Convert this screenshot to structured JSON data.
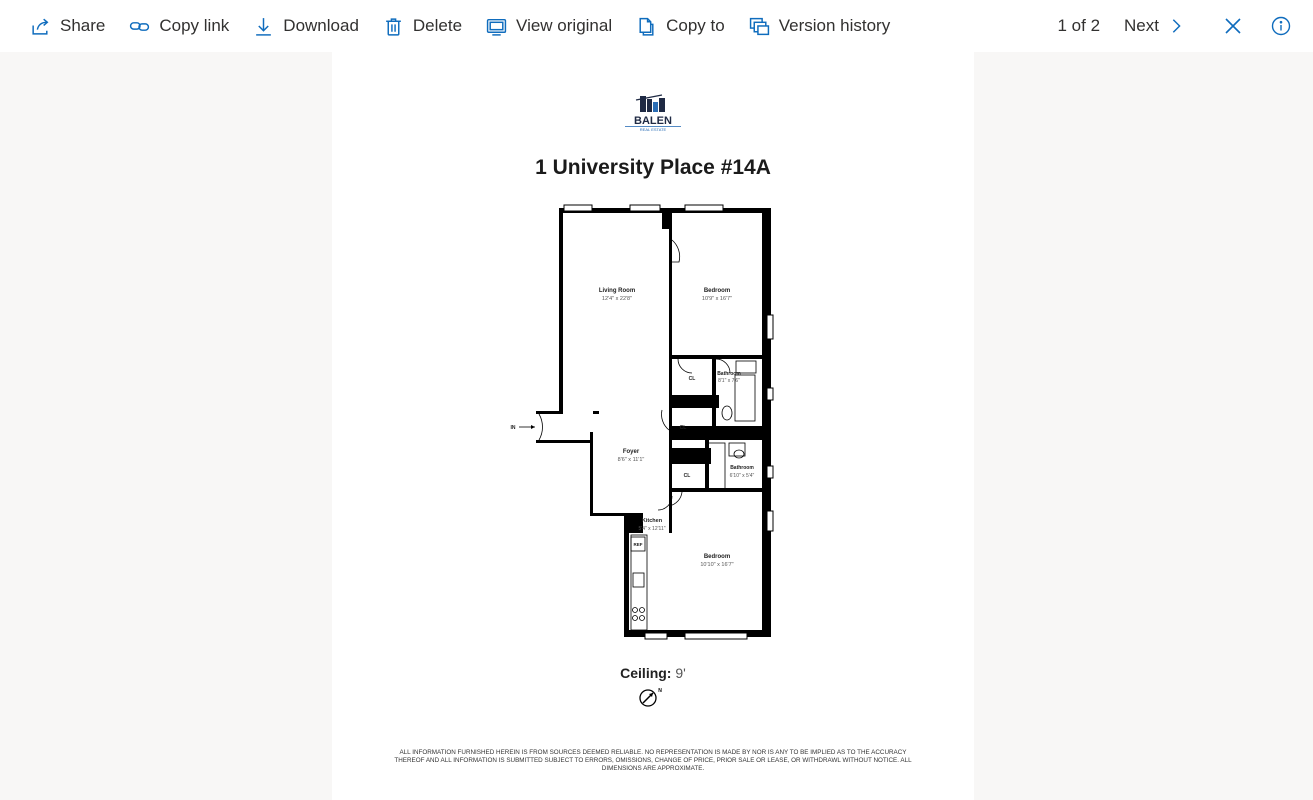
{
  "toolbar": {
    "share": "Share",
    "copy_link": "Copy link",
    "download": "Download",
    "delete": "Delete",
    "view_original": "View original",
    "copy_to": "Copy to",
    "version_history": "Version history",
    "counter": "1 of 2",
    "next": "Next"
  },
  "document": {
    "logo_text": "BALEN",
    "logo_subtext": "REAL ESTATE",
    "title": "1 University Place #14A",
    "entry_label": "IN",
    "rooms": [
      {
        "name": "Living Room",
        "dims": "12'4\" x 22'8\""
      },
      {
        "name": "Bedroom",
        "dims": "10'9\" x 16'7\""
      },
      {
        "name": "Bathroom",
        "dims": "8'1\" x 7'6\""
      },
      {
        "name": "Foyer",
        "dims": "8'6\" x 11'1\""
      },
      {
        "name": "Bathroom",
        "dims": "6'10\" x 5'4\""
      },
      {
        "name": "Kitchen",
        "dims": "5'4\" x 12'11\""
      },
      {
        "name": "Bedroom",
        "dims": "10'10\" x 16'7\""
      }
    ],
    "closets": [
      "CL",
      "CL",
      "CL"
    ],
    "appliance_label": "REF",
    "ceiling_label": "Ceiling:",
    "ceiling_value": "9'",
    "compass_label": "N",
    "disclaimer": "ALL INFORMATION FURNISHED HEREIN IS FROM SOURCES DEEMED RELIABLE. NO REPRESENTATION IS MADE BY NOR IS ANY TO BE IMPLIED AS TO THE ACCURACY THEREOF AND ALL INFORMATION IS SUBMITTED SUBJECT TO ERRORS, OMISSIONS, CHANGE OF PRICE, PRIOR SALE OR LEASE, OR WITHDRAWL WITHOUT NOTICE. ALL DIMENSIONS ARE APPROXIMATE."
  },
  "colors": {
    "accent": "#0f6cbd",
    "toolbar_bg": "#ffffff",
    "viewer_bg": "#f8f7f6",
    "logo_navy": "#1f2a44",
    "logo_blue": "#2a6db5"
  },
  "icons": [
    "share-icon",
    "copy-link-icon",
    "download-icon",
    "delete-icon",
    "view-original-icon",
    "copy-to-icon",
    "version-history-icon",
    "chevron-right-icon",
    "close-icon",
    "info-icon"
  ]
}
